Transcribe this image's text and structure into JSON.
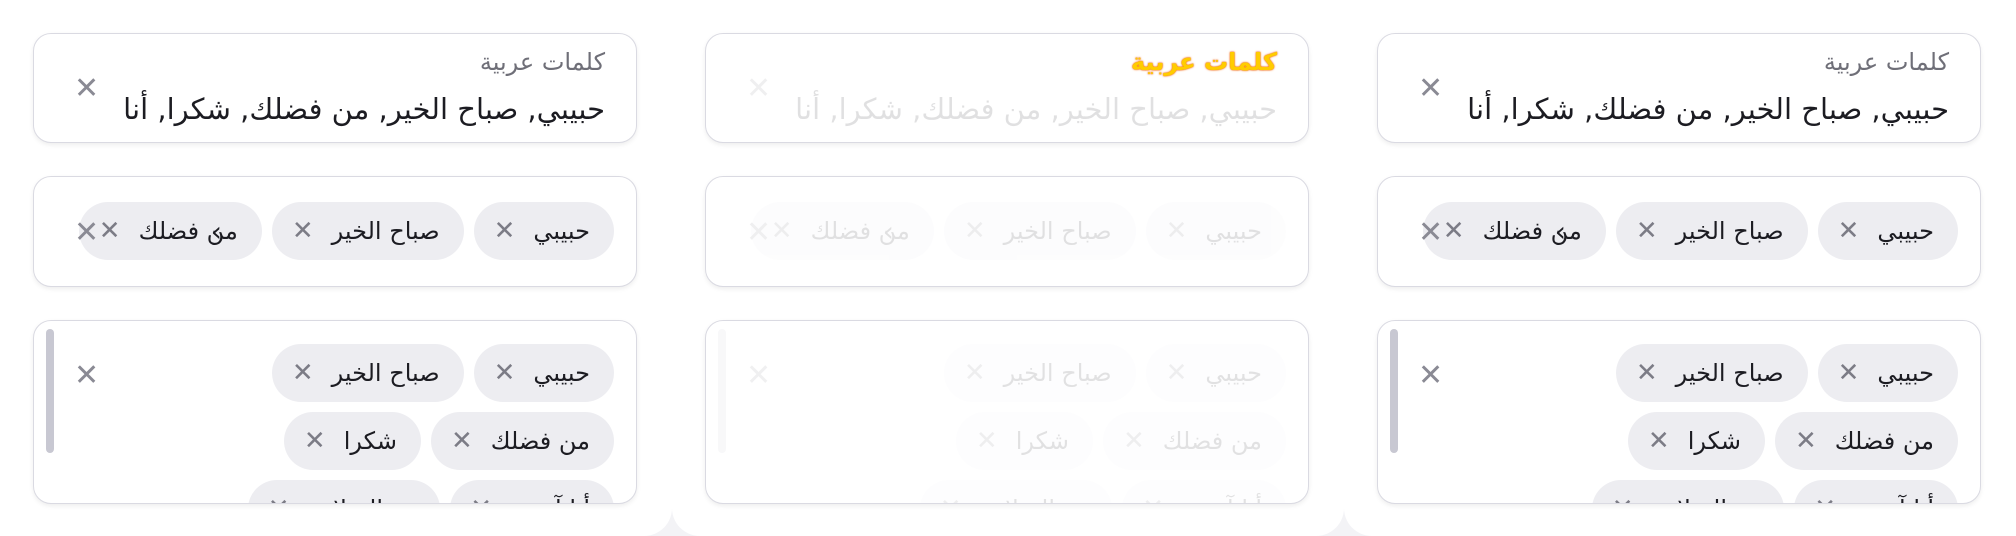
{
  "label": "كلمات عربية",
  "value_text": "حبيبي, صباح الخير, من فضلك, شكرا, أنا",
  "clear_glyph": "✕",
  "chip_close_glyph": "✕",
  "chips_row": [
    "حبيبي",
    "صباح الخير",
    "من فضلك"
  ],
  "scroll_arrow": "›",
  "wrap_rows": [
    [
      "حبيبي",
      "صباح الخير"
    ],
    [
      "من فضلك",
      "شكرا"
    ],
    [
      "أنا آسف",
      "مع السلامة"
    ]
  ],
  "colors": {
    "background": "#f3f3f6",
    "field_border": "#dadae2",
    "chip_bg": "#ededf1",
    "label_glow": "#ffcc00"
  }
}
